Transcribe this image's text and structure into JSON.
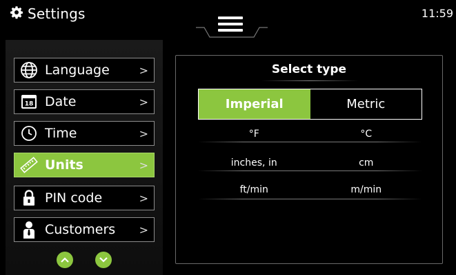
{
  "header": {
    "title": "Settings",
    "time": "11:59",
    "icons": {
      "title": "gear-icon",
      "menu": "hamburger-menu-icon"
    }
  },
  "sidebar": {
    "items": [
      {
        "label": "Language",
        "icon": "globe-icon",
        "active": false
      },
      {
        "label": "Date",
        "icon": "calendar-icon",
        "icon_text": "18",
        "active": false
      },
      {
        "label": "Time",
        "icon": "clock-icon",
        "active": false
      },
      {
        "label": "Units",
        "icon": "ruler-icon",
        "active": true
      },
      {
        "label": "PIN code",
        "icon": "lock-icon",
        "active": false
      },
      {
        "label": "Customers",
        "icon": "person-icon",
        "active": false
      }
    ],
    "chevron": ">",
    "scroll_icons": [
      "chevron-up-icon",
      "chevron-down-icon"
    ]
  },
  "main": {
    "title": "Select type",
    "options": [
      {
        "label": "Imperial",
        "selected": true
      },
      {
        "label": "Metric",
        "selected": false
      }
    ],
    "rows": [
      {
        "imperial": "°F",
        "metric": "°C"
      },
      {
        "imperial": "inches, in",
        "metric": "cm"
      },
      {
        "imperial": "ft/min",
        "metric": "m/min"
      }
    ]
  },
  "colors": {
    "accent": "#8cc63f",
    "background": "#000000",
    "border": "#8e8e8e",
    "text": "#ffffff"
  }
}
